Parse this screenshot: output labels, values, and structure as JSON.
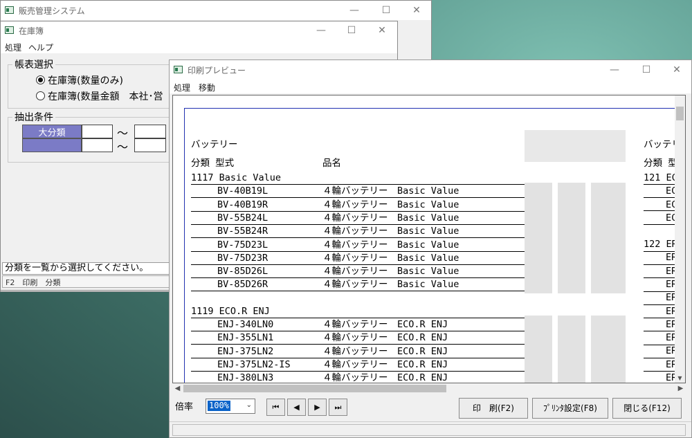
{
  "main_window": {
    "title": "販売管理システム",
    "controls": {
      "minimize": "—",
      "maximize": "☐",
      "close": "✕"
    }
  },
  "stock_window": {
    "title": "在庫簿",
    "menu": [
      "処理",
      "ヘルプ"
    ],
    "report_group": {
      "label": "帳表選択",
      "options": [
        {
          "label": "在庫簿(数量のみ)",
          "selected": true
        },
        {
          "label": "在庫簿(数量金額　本社･営",
          "selected": false
        }
      ]
    },
    "filter_group": {
      "label": "抽出条件",
      "row1_label": "大分類",
      "tilde": "～"
    },
    "status_text": "分類を一覧から選択してください。",
    "fkey_text": "F2　印刷　分類"
  },
  "preview_window": {
    "title": "印刷プレビュー",
    "menu": [
      "処理",
      "移動"
    ],
    "report": {
      "section_title": "バッテリー",
      "col_category_model": "分類 型式",
      "col_name": "品名",
      "groups": [
        {
          "header": "1117 Basic Value",
          "rows": [
            {
              "model": "BV-40B19L",
              "name": "４輪バッテリー　Basic Value"
            },
            {
              "model": "BV-40B19R",
              "name": "４輪バッテリー　Basic Value"
            },
            {
              "model": "BV-55B24L",
              "name": "４輪バッテリー　Basic Value"
            },
            {
              "model": "BV-55B24R",
              "name": "４輪バッテリー　Basic Value"
            },
            {
              "model": "BV-75D23L",
              "name": "４輪バッテリー　Basic Value"
            },
            {
              "model": "BV-75D23R",
              "name": "４輪バッテリー　Basic Value"
            },
            {
              "model": "BV-85D26L",
              "name": "４輪バッテリー　Basic Value"
            },
            {
              "model": "BV-85D26R",
              "name": "４輪バッテリー　Basic Value"
            }
          ]
        },
        {
          "header": "1119 ECO.R ENJ",
          "rows": [
            {
              "model": "ENJ-340LN0",
              "name": "４輪バッテリー　ECO.R ENJ"
            },
            {
              "model": "ENJ-355LN1",
              "name": "４輪バッテリー　ECO.R ENJ"
            },
            {
              "model": "ENJ-375LN2",
              "name": "４輪バッテリー　ECO.R ENJ"
            },
            {
              "model": "ENJ-375LN2-IS",
              "name": "４輪バッテリー　ECO.R ENJ"
            },
            {
              "model": "ENJ-380LN3",
              "name": "４輪バッテリー　ECO.R ENJ"
            }
          ]
        }
      ],
      "right_column": {
        "section_title": "バッテリ",
        "col_header": "分類 型",
        "group1": "121 EC",
        "group1_rows": [
          "EC",
          "EC",
          "EC"
        ],
        "group2": "122 ER",
        "group2_rows": [
          "ER",
          "ER",
          "ER",
          "ER",
          "ER",
          "ER",
          "ER",
          "ER",
          "ER",
          "ER"
        ]
      }
    },
    "zoom_label": "倍率",
    "zoom_value": "100%",
    "nav": {
      "first": "⏮",
      "prev": "◀",
      "next": "▶",
      "last": "⏭"
    },
    "buttons": {
      "print": "印　刷(F2)",
      "printer_setup": "ﾌﾟﾘﾝﾀ設定(F8)",
      "close": "閉じる(F12)"
    }
  }
}
